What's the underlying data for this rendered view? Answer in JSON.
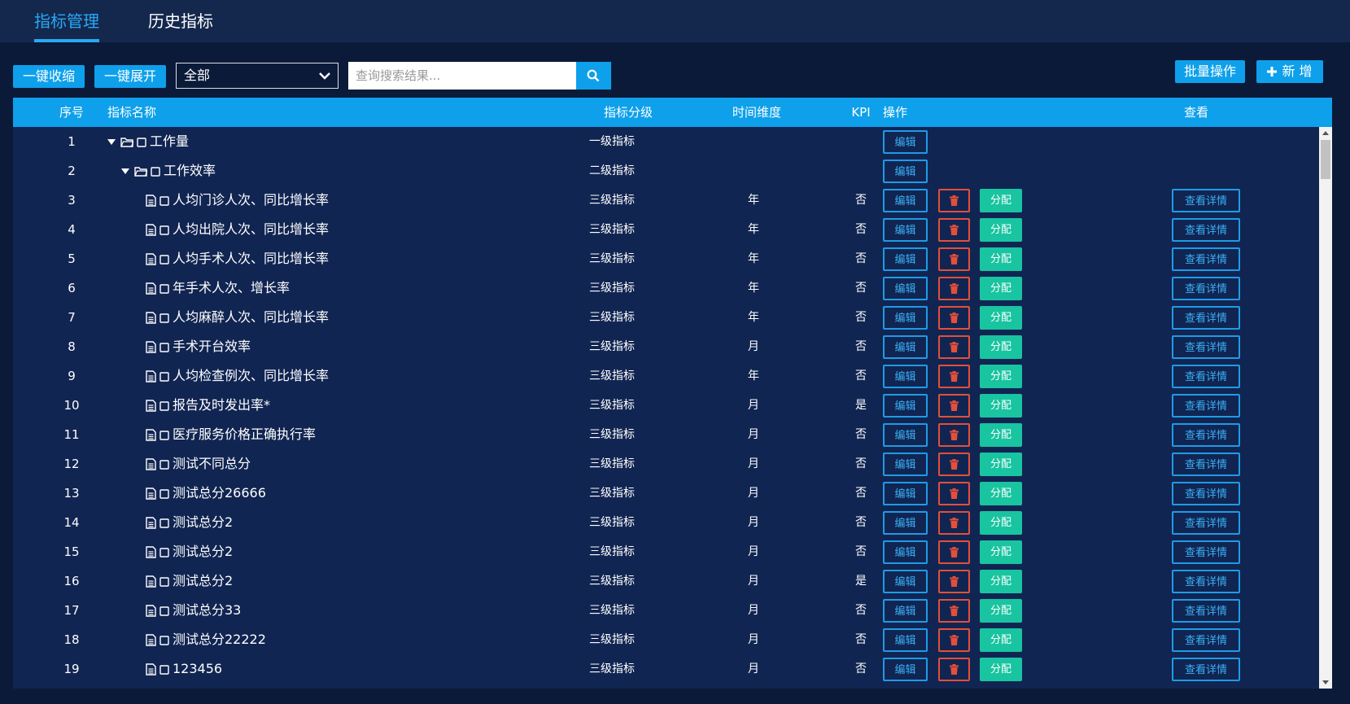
{
  "tabs": [
    {
      "label": "指标管理",
      "active": true
    },
    {
      "label": "历史指标",
      "active": false
    }
  ],
  "toolbar": {
    "collapse_label": "一键收缩",
    "expand_label": "一键展开",
    "filter_value": "全部",
    "search_placeholder": "查询搜索结果...",
    "batch_label": "批量操作",
    "add_label": "新 增"
  },
  "table": {
    "headers": {
      "index": "序号",
      "name": "指标名称",
      "level": "指标分级",
      "time": "时间维度",
      "kpi": "KPI",
      "ops": "操作",
      "view": "查看"
    },
    "edit_label": "编辑",
    "assign_label": "分配",
    "view_label": "查看详情",
    "rows": [
      {
        "index": "1",
        "name": "工作量",
        "level": "一级指标",
        "time": "",
        "kpi": "",
        "type": "folder",
        "depth": 0
      },
      {
        "index": "2",
        "name": "工作效率",
        "level": "二级指标",
        "time": "",
        "kpi": "",
        "type": "folder",
        "depth": 1
      },
      {
        "index": "3",
        "name": "人均门诊人次、同比增长率",
        "level": "三级指标",
        "time": "年",
        "kpi": "否",
        "type": "file",
        "depth": 2
      },
      {
        "index": "4",
        "name": "人均出院人次、同比增长率",
        "level": "三级指标",
        "time": "年",
        "kpi": "否",
        "type": "file",
        "depth": 2
      },
      {
        "index": "5",
        "name": "人均手术人次、同比增长率",
        "level": "三级指标",
        "time": "年",
        "kpi": "否",
        "type": "file",
        "depth": 2
      },
      {
        "index": "6",
        "name": "年手术人次、增长率",
        "level": "三级指标",
        "time": "年",
        "kpi": "否",
        "type": "file",
        "depth": 2
      },
      {
        "index": "7",
        "name": "人均麻醉人次、同比增长率",
        "level": "三级指标",
        "time": "年",
        "kpi": "否",
        "type": "file",
        "depth": 2
      },
      {
        "index": "8",
        "name": "手术开台效率",
        "level": "三级指标",
        "time": "月",
        "kpi": "否",
        "type": "file",
        "depth": 2
      },
      {
        "index": "9",
        "name": "人均检查例次、同比增长率",
        "level": "三级指标",
        "time": "年",
        "kpi": "否",
        "type": "file",
        "depth": 2
      },
      {
        "index": "10",
        "name": "报告及时发出率*",
        "level": "三级指标",
        "time": "月",
        "kpi": "是",
        "type": "file",
        "depth": 2
      },
      {
        "index": "11",
        "name": "医疗服务价格正确执行率",
        "level": "三级指标",
        "time": "月",
        "kpi": "否",
        "type": "file",
        "depth": 2
      },
      {
        "index": "12",
        "name": "测试不同总分",
        "level": "三级指标",
        "time": "月",
        "kpi": "否",
        "type": "file",
        "depth": 2
      },
      {
        "index": "13",
        "name": "测试总分26666",
        "level": "三级指标",
        "time": "月",
        "kpi": "否",
        "type": "file",
        "depth": 2
      },
      {
        "index": "14",
        "name": "测试总分2",
        "level": "三级指标",
        "time": "月",
        "kpi": "否",
        "type": "file",
        "depth": 2
      },
      {
        "index": "15",
        "name": "测试总分2",
        "level": "三级指标",
        "time": "月",
        "kpi": "否",
        "type": "file",
        "depth": 2
      },
      {
        "index": "16",
        "name": "测试总分2",
        "level": "三级指标",
        "time": "月",
        "kpi": "是",
        "type": "file",
        "depth": 2
      },
      {
        "index": "17",
        "name": "测试总分33",
        "level": "三级指标",
        "time": "月",
        "kpi": "否",
        "type": "file",
        "depth": 2
      },
      {
        "index": "18",
        "name": "测试总分22222",
        "level": "三级指标",
        "time": "月",
        "kpi": "否",
        "type": "file",
        "depth": 2
      },
      {
        "index": "19",
        "name": "123456",
        "level": "三级指标",
        "time": "月",
        "kpi": "否",
        "type": "file",
        "depth": 2
      }
    ]
  },
  "icons": {
    "caret": "caret-down-icon",
    "folder": "folder-open-icon",
    "file": "document-icon",
    "checkbox": "checkbox-icon",
    "trash": "trash-icon",
    "search": "search-icon",
    "plus": "plus-icon",
    "chevron": "chevron-down-icon"
  },
  "colors": {
    "background": "#0c1a3a",
    "topbar": "#14284e",
    "accent": "#0ea0ea",
    "table_body": "#112552",
    "delete": "#e34f3a",
    "assign": "#19c4a0"
  }
}
